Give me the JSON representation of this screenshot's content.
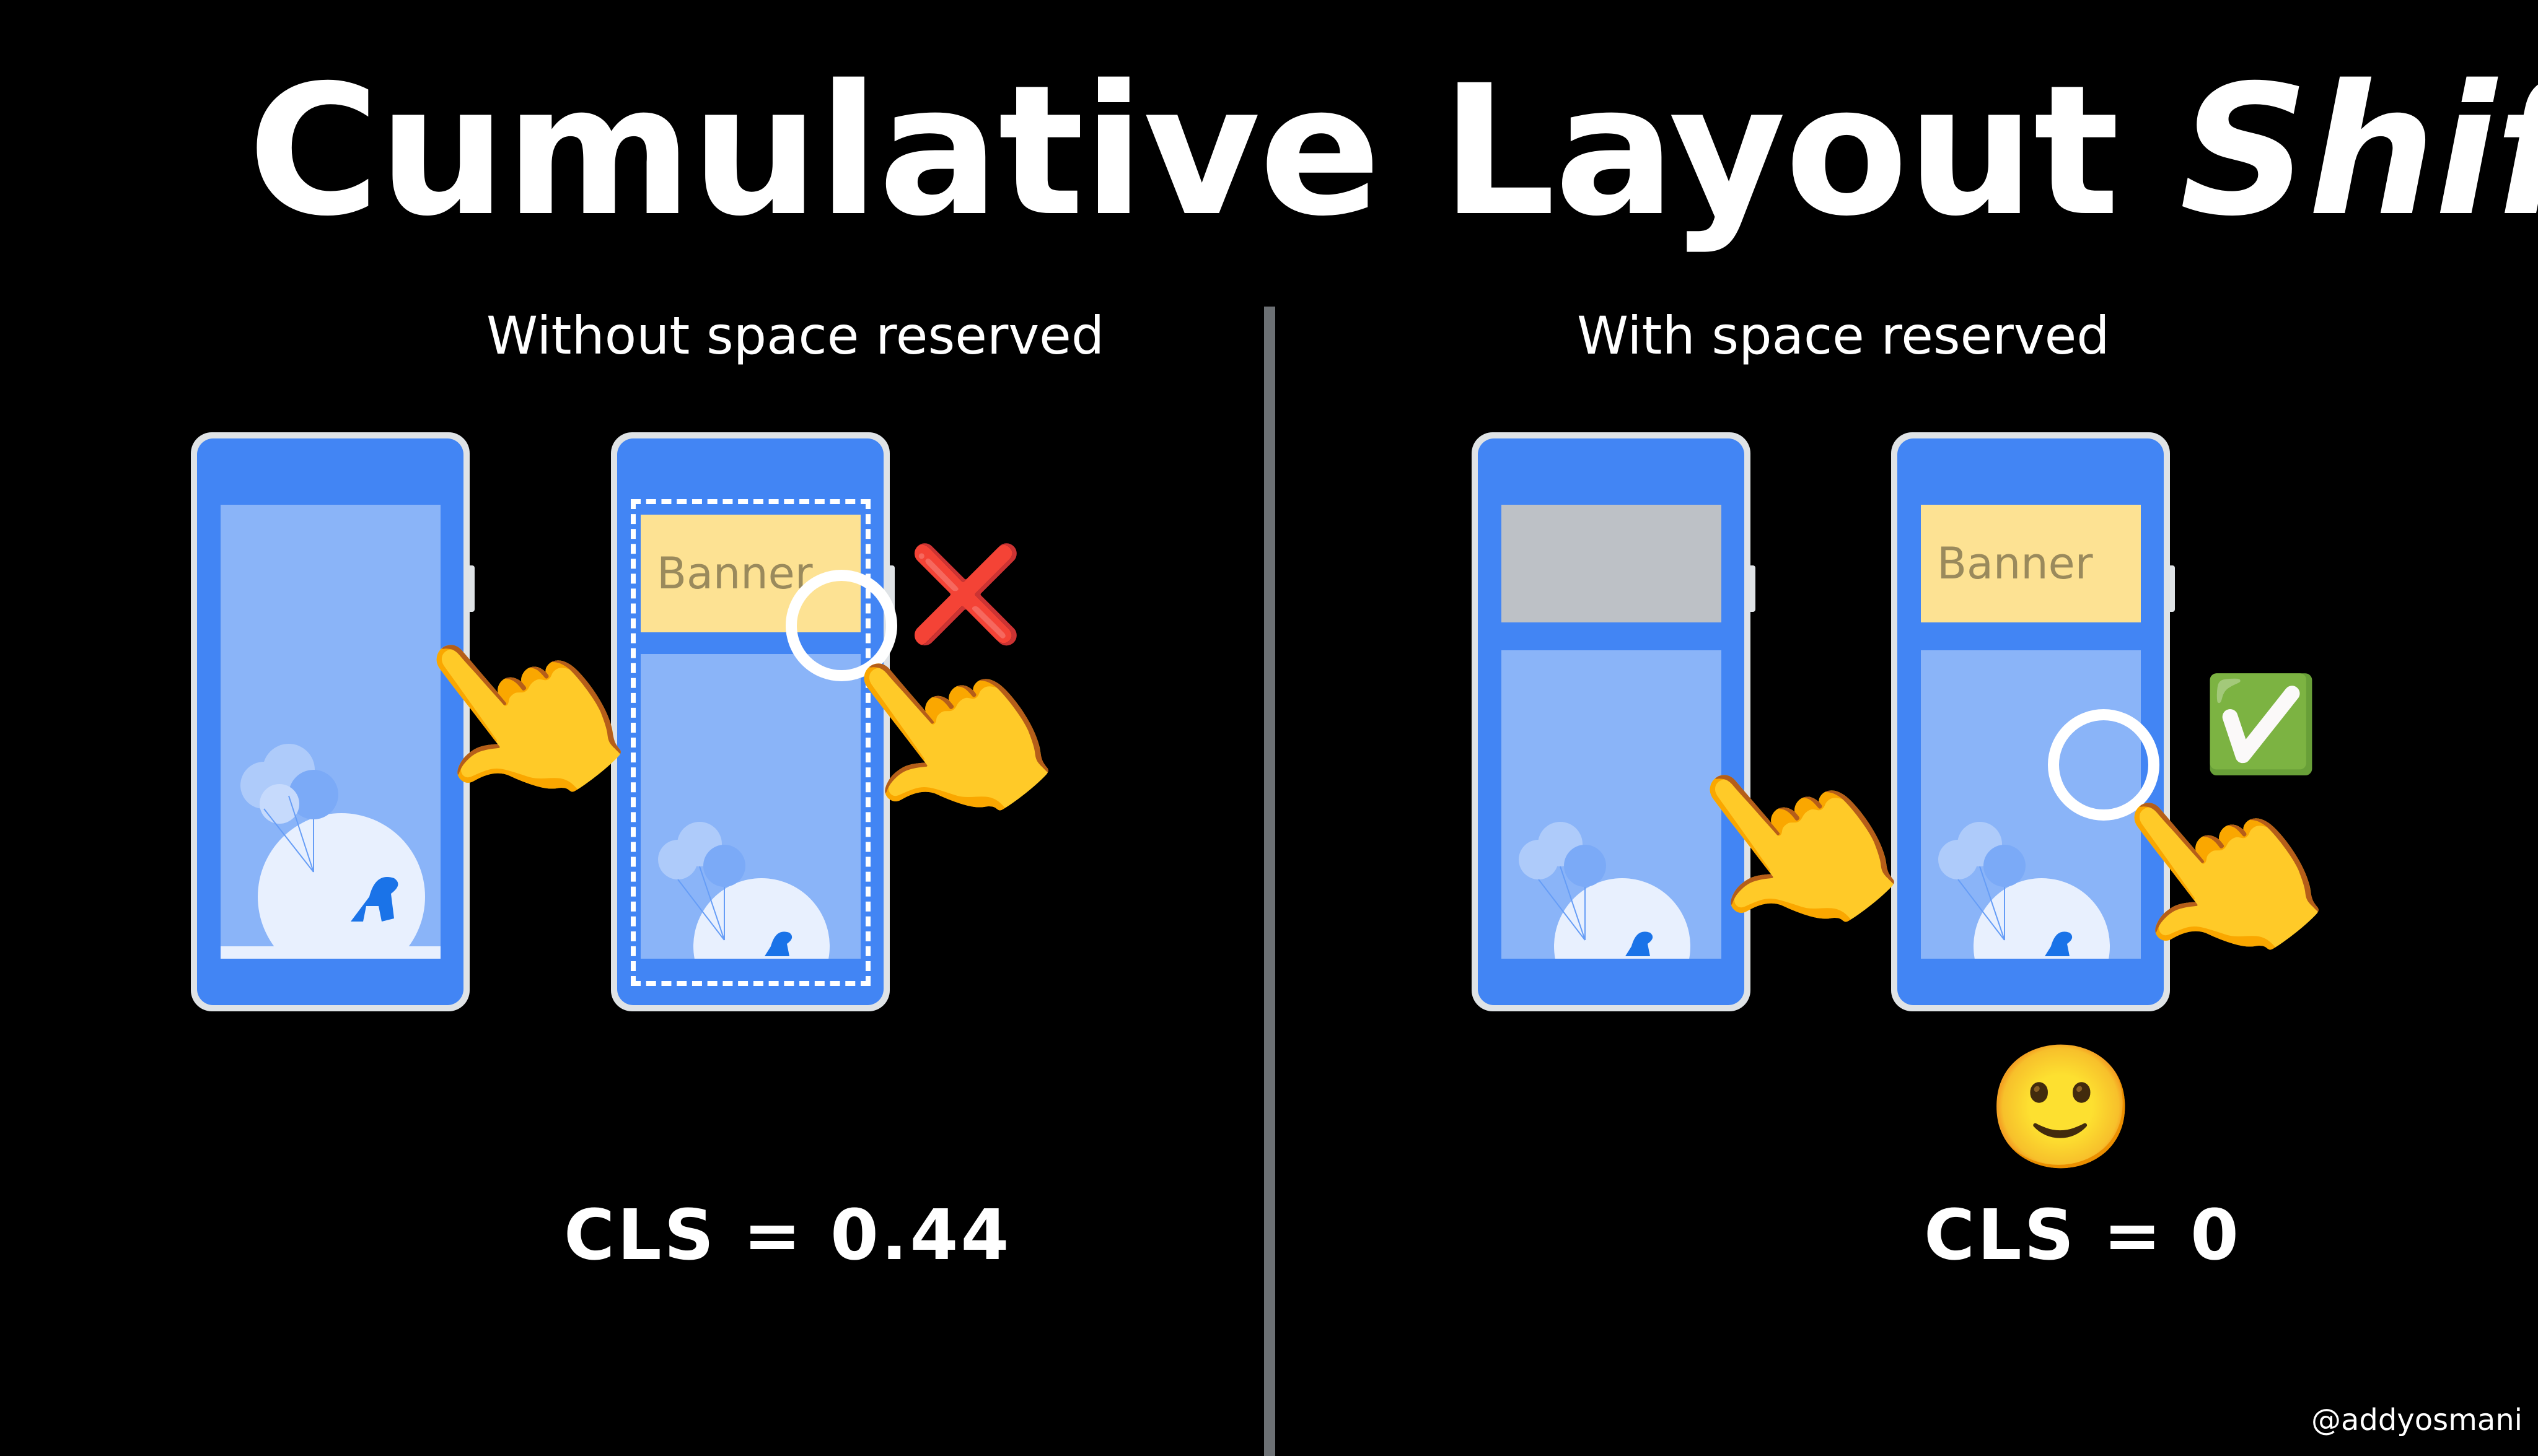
{
  "title": {
    "main": "Cumulative Layout ",
    "italic": "Shift"
  },
  "left": {
    "subtitle": "Without space reserved",
    "banner_label": "Banner",
    "result_emoji": "😭",
    "cross_mark": "❌",
    "cls_text": "CLS = 0.44"
  },
  "right": {
    "subtitle": "With space reserved",
    "banner_label": "Banner",
    "result_emoji": "🙂",
    "check_mark": "✅",
    "cls_text": "CLS = 0"
  },
  "pointer_emoji": "👆",
  "credit": "@addyosmani",
  "colors": {
    "background": "#000000",
    "phone_frame": "#dfe3e6",
    "screen_blue": "#4285f4",
    "content_light_blue": "#8ab4f8",
    "banner_yellow": "#fde293",
    "placeholder_gray": "#bdc1c6",
    "divider": "#6c7074"
  }
}
